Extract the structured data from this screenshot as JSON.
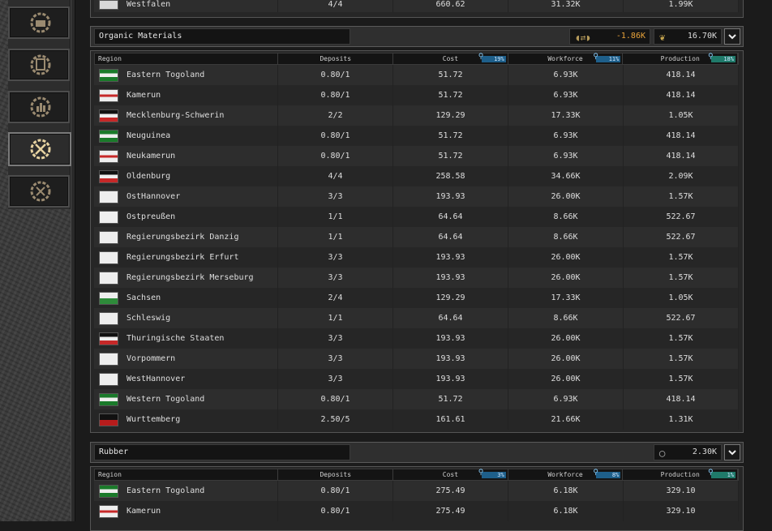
{
  "sidebar": {
    "buttons": [
      {
        "icon": "factory-gear-icon"
      },
      {
        "icon": "document-gear-icon"
      },
      {
        "icon": "chart-gear-icon"
      },
      {
        "icon": "pickaxe-gear-icon",
        "active": true
      },
      {
        "icon": "tools-gear-icon"
      }
    ]
  },
  "top_row": {
    "region": "Westfalen",
    "deposits": "4/4",
    "cost": "660.62",
    "workforce": "31.32K",
    "production": "1.99K"
  },
  "columns": {
    "region": "Region",
    "deposits": "Deposits",
    "cost": "Cost",
    "workforce": "Workforce",
    "production": "Production"
  },
  "organic": {
    "title": "Organic Materials",
    "balance": "-1.86K",
    "total": "16.70K",
    "badges": {
      "cost": "19%",
      "workforce": "11%",
      "production": "18%"
    },
    "rows": [
      {
        "region": "Eastern Togoland",
        "flag": "togo",
        "deposits": "0.80/1",
        "cost": "51.72",
        "workforce": "6.93K",
        "production": "418.14"
      },
      {
        "region": "Kamerun",
        "flag": "kamerun",
        "deposits": "0.80/1",
        "cost": "51.72",
        "workforce": "6.93K",
        "production": "418.14"
      },
      {
        "region": "Mecklenburg-Schwerin",
        "flag": "empire",
        "deposits": "2/2",
        "cost": "129.29",
        "workforce": "17.33K",
        "production": "1.05K"
      },
      {
        "region": "Neuguinea",
        "flag": "togo",
        "deposits": "0.80/1",
        "cost": "51.72",
        "workforce": "6.93K",
        "production": "418.14"
      },
      {
        "region": "Neukamerun",
        "flag": "kamerun",
        "deposits": "0.80/1",
        "cost": "51.72",
        "workforce": "6.93K",
        "production": "418.14"
      },
      {
        "region": "Oldenburg",
        "flag": "empire",
        "deposits": "4/4",
        "cost": "258.58",
        "workforce": "34.66K",
        "production": "2.09K"
      },
      {
        "region": "OstHannover",
        "flag": "prussia",
        "deposits": "3/3",
        "cost": "193.93",
        "workforce": "26.00K",
        "production": "1.57K"
      },
      {
        "region": "Ostpreußen",
        "flag": "prussia",
        "deposits": "1/1",
        "cost": "64.64",
        "workforce": "8.66K",
        "production": "522.67"
      },
      {
        "region": "Regierungsbezirk Danzig",
        "flag": "prussia",
        "deposits": "1/1",
        "cost": "64.64",
        "workforce": "8.66K",
        "production": "522.67"
      },
      {
        "region": "Regierungsbezirk Erfurt",
        "flag": "prussia",
        "deposits": "3/3",
        "cost": "193.93",
        "workforce": "26.00K",
        "production": "1.57K"
      },
      {
        "region": "Regierungsbezirk Merseburg",
        "flag": "prussia",
        "deposits": "3/3",
        "cost": "193.93",
        "workforce": "26.00K",
        "production": "1.57K"
      },
      {
        "region": "Sachsen",
        "flag": "sachsen",
        "deposits": "2/4",
        "cost": "129.29",
        "workforce": "17.33K",
        "production": "1.05K"
      },
      {
        "region": "Schleswig",
        "flag": "prussia",
        "deposits": "1/1",
        "cost": "64.64",
        "workforce": "8.66K",
        "production": "522.67"
      },
      {
        "region": "Thuringische Staaten",
        "flag": "empire",
        "deposits": "3/3",
        "cost": "193.93",
        "workforce": "26.00K",
        "production": "1.57K"
      },
      {
        "region": "Vorpommern",
        "flag": "prussia",
        "deposits": "3/3",
        "cost": "193.93",
        "workforce": "26.00K",
        "production": "1.57K"
      },
      {
        "region": "WestHannover",
        "flag": "prussia",
        "deposits": "3/3",
        "cost": "193.93",
        "workforce": "26.00K",
        "production": "1.57K"
      },
      {
        "region": "Western Togoland",
        "flag": "togo",
        "deposits": "0.80/1",
        "cost": "51.72",
        "workforce": "6.93K",
        "production": "418.14"
      },
      {
        "region": "Wurttemberg",
        "flag": "wurttemberg",
        "deposits": "2.50/5",
        "cost": "161.61",
        "workforce": "21.66K",
        "production": "1.31K"
      }
    ]
  },
  "rubber": {
    "title": "Rubber",
    "total": "2.30K",
    "badges": {
      "cost": "3%",
      "workforce": "8%",
      "production": "1%"
    },
    "rows": [
      {
        "region": "Eastern Togoland",
        "flag": "togo",
        "deposits": "0.80/1",
        "cost": "275.49",
        "workforce": "6.18K",
        "production": "329.10"
      },
      {
        "region": "Kamerun",
        "flag": "kamerun",
        "deposits": "0.80/1",
        "cost": "275.49",
        "workforce": "6.18K",
        "production": "329.10"
      }
    ]
  },
  "colors": {
    "negative": "#e8a33a",
    "badge_blue": "#1e5f8a",
    "badge_teal": "#1f7a6a"
  }
}
